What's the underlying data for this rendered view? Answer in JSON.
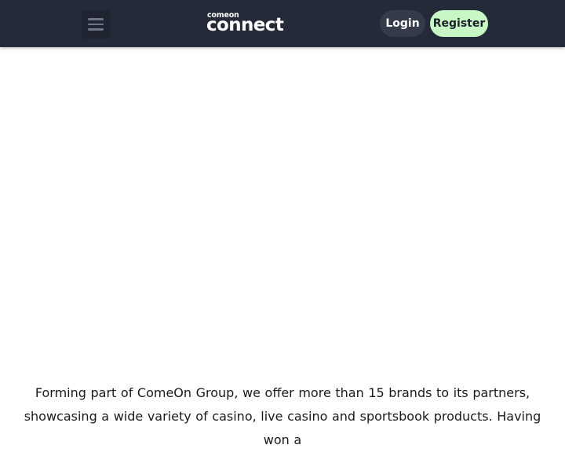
{
  "header": {
    "menu_icon": "hamburger-menu-icon",
    "logo": {
      "small_text": "comeon",
      "large_text": "connect"
    },
    "login_label": "Login",
    "register_label": "Register"
  },
  "colors": {
    "header_background": "#242a38",
    "login_background": "#353b49",
    "register_background": "#c8f7c6",
    "body_text": "#1a1a1a"
  },
  "main": {
    "intro_text": "Forming part of ComeOn Group, we offer more than 15 brands to its partners, showcasing a wide variety of casino, live casino and sportsbook products. Having won a"
  }
}
